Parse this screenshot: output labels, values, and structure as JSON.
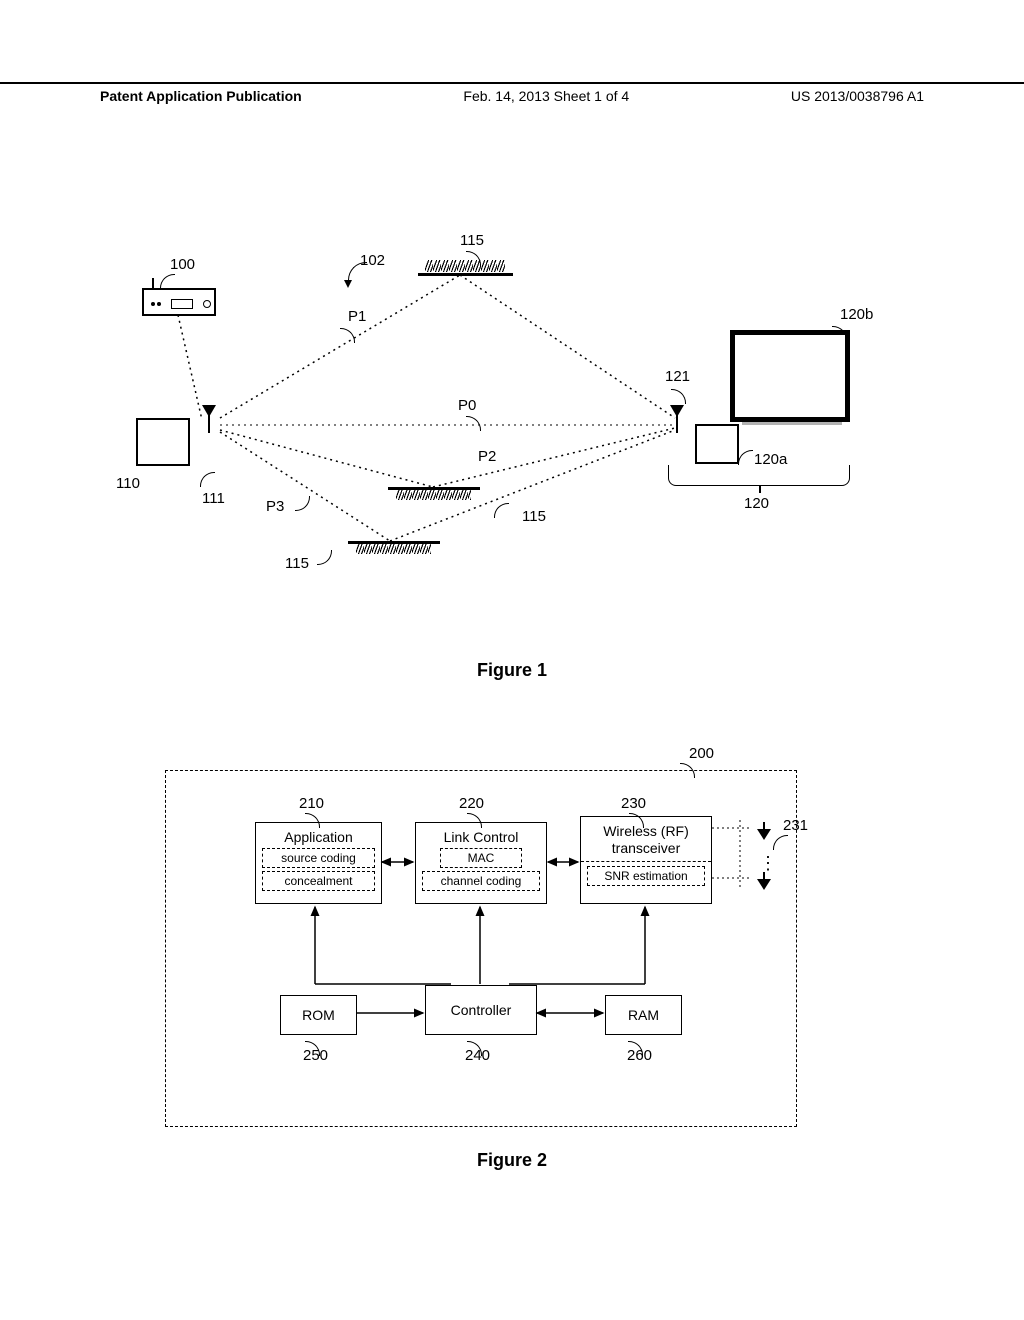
{
  "header": {
    "left": "Patent Application Publication",
    "center": "Feb. 14, 2013  Sheet 1 of 4",
    "right": "US 2013/0038796 A1"
  },
  "figure1": {
    "caption": "Figure 1",
    "labels": {
      "l100": "100",
      "l102": "102",
      "l110": "110",
      "l111": "111",
      "l115a": "115",
      "l115b": "115",
      "l115c": "115",
      "l120": "120",
      "l120a": "120a",
      "l120b": "120b",
      "l121": "121",
      "P0": "P0",
      "P1": "P1",
      "P2": "P2",
      "P3": "P3"
    }
  },
  "figure2": {
    "caption": "Figure 2",
    "num200": "200",
    "labels": {
      "l210": "210",
      "l220": "220",
      "l230": "230",
      "l231": "231",
      "l240": "240",
      "l250": "250",
      "l260": "260"
    },
    "modules": {
      "app": {
        "title": "Application",
        "s1": "source coding",
        "s2": "concealment"
      },
      "link": {
        "title": "Link Control",
        "s1": "MAC",
        "s2": "channel coding"
      },
      "rf": {
        "title": "Wireless (RF) transceiver",
        "s1": "SNR estimation"
      },
      "rom": "ROM",
      "ctrl": "Controller",
      "ram": "RAM"
    }
  }
}
